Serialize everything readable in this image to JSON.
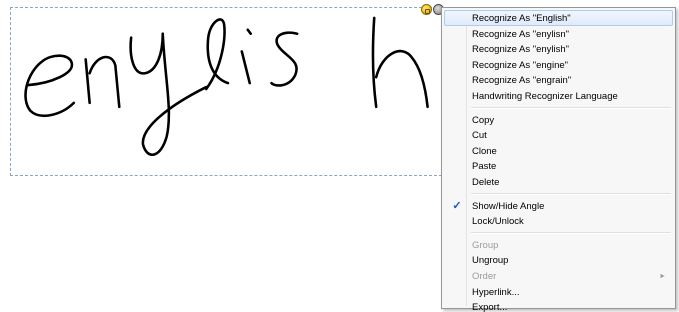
{
  "ink": {
    "handwriting_text": "english"
  },
  "context_menu": {
    "recognize_items": [
      {
        "label": "Recognize As \"English\"",
        "highlighted": true
      },
      {
        "label": "Recognize As \"enylisn\""
      },
      {
        "label": "Recognize As \"enylish\""
      },
      {
        "label": "Recognize As \"engine\""
      },
      {
        "label": "Recognize As \"engrain\""
      },
      {
        "label": "Handwriting Recognizer Language"
      }
    ],
    "edit_items": [
      {
        "label": "Copy"
      },
      {
        "label": "Cut"
      },
      {
        "label": "Clone"
      },
      {
        "label": "Paste"
      },
      {
        "label": "Delete"
      }
    ],
    "toggle_items": [
      {
        "label": "Show/Hide Angle",
        "checked": true
      },
      {
        "label": "Lock/Unlock"
      }
    ],
    "object_items": [
      {
        "label": "Group",
        "disabled": true
      },
      {
        "label": "Ungroup"
      },
      {
        "label": "Order",
        "disabled": true,
        "has_submenu": true
      },
      {
        "label": "Hyperlink..."
      },
      {
        "label": "Export..."
      }
    ],
    "check_glyph": "✓",
    "submenu_glyph": "►"
  },
  "colors": {
    "highlight_border": "#aecbf0",
    "check": "#1a56c0",
    "disabled_text": "#9b9b9b"
  }
}
